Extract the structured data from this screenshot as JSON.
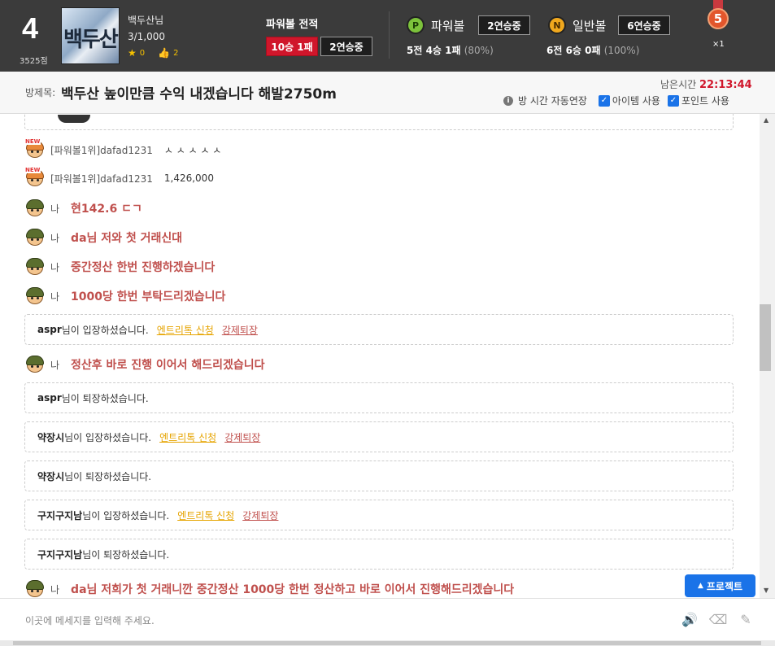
{
  "header": {
    "rank": "4",
    "score": "3525점",
    "avatar_text": "백두산",
    "username": "백두산님",
    "user_count": "3/1,000",
    "stars": "0",
    "likes": "2",
    "powerball_record_title": "파워볼 전적",
    "record_win_loss": "10승 1패",
    "record_streak": "2연승중",
    "powerball": {
      "icon_letter": "P",
      "label": "파워볼",
      "streak": "2연승중",
      "record": "5전 4승 1패",
      "pct": "(80%)"
    },
    "normalball": {
      "icon_letter": "N",
      "label": "일반볼",
      "streak": "6연승중",
      "record": "6전 6승 0패",
      "pct": "(100%)"
    },
    "medal_number": "5",
    "medal_count": "×1"
  },
  "room": {
    "label": "방제목:",
    "title": "백두산 높이만큼 수익 내겠습니다 해발2750m",
    "remain_label": "남은시간",
    "remain_time": "22:13:44",
    "auto_extend": "방 시간 자동연장",
    "item_use": "아이템 사용",
    "point_use": "포인트 사용"
  },
  "chat": {
    "messages": [
      {
        "who": "[파워볼1위]dafad1231",
        "text": "ㅅ ㅅ ㅅ ㅅ ㅅ",
        "type": "other"
      },
      {
        "who": "[파워볼1위]dafad1231",
        "text": "1,426,000",
        "type": "other"
      },
      {
        "who": "나",
        "text": "현142.6 ㄷㄱ",
        "type": "me"
      },
      {
        "who": "나",
        "text": "da님 저와 첫 거래신대",
        "type": "me"
      },
      {
        "who": "나",
        "text": "중간정산 한번 진행하겠습니다",
        "type": "me"
      },
      {
        "who": "나",
        "text": "1000당 한번 부탁드리겠습니다",
        "type": "me"
      },
      {
        "who": "나",
        "text": "정산후 바로 진행 이어서 해드리겠습니다",
        "type": "me"
      },
      {
        "who": "나",
        "text": "da님 저희가 첫 거래니깐 중간정산 1000당 한번 정산하고 바로 이어서 진행해드리겠습니다",
        "type": "me"
      }
    ],
    "notices": [
      {
        "name": "aspr",
        "text": "님이 입장하셨습니다.",
        "entry": "엔트리톡 신청",
        "kick": "강제퇴장"
      },
      {
        "name": "aspr",
        "text": "님이 퇴장하셨습니다."
      },
      {
        "name": "약장시",
        "text": "님이 입장하셨습니다.",
        "entry": "엔트리톡 신청",
        "kick": "강제퇴장"
      },
      {
        "name": "약장시",
        "text": "님이 퇴장하셨습니다."
      },
      {
        "name": "구지구지남",
        "text": "님이 입장하셨습니다.",
        "entry": "엔트리톡 신청",
        "kick": "강제퇴장"
      },
      {
        "name": "구지구지남",
        "text": "님이 퇴장하셨습니다."
      }
    ]
  },
  "project_button": "프로젝트",
  "input": {
    "placeholder": "이곳에 메세지를 입력해 주세요."
  },
  "icons": {
    "star": "★",
    "thumb": "👍",
    "info": "i",
    "check": "✓",
    "speaker": "🔊",
    "eraser": "⌫",
    "wand": "✎",
    "up": "▲",
    "down": "▼",
    "project_arrow": "▲"
  },
  "colors": {
    "accent": "#1a73e8",
    "me_text": "#c0504d",
    "record_red": "#d0162b",
    "entry_link": "#e6a400"
  }
}
